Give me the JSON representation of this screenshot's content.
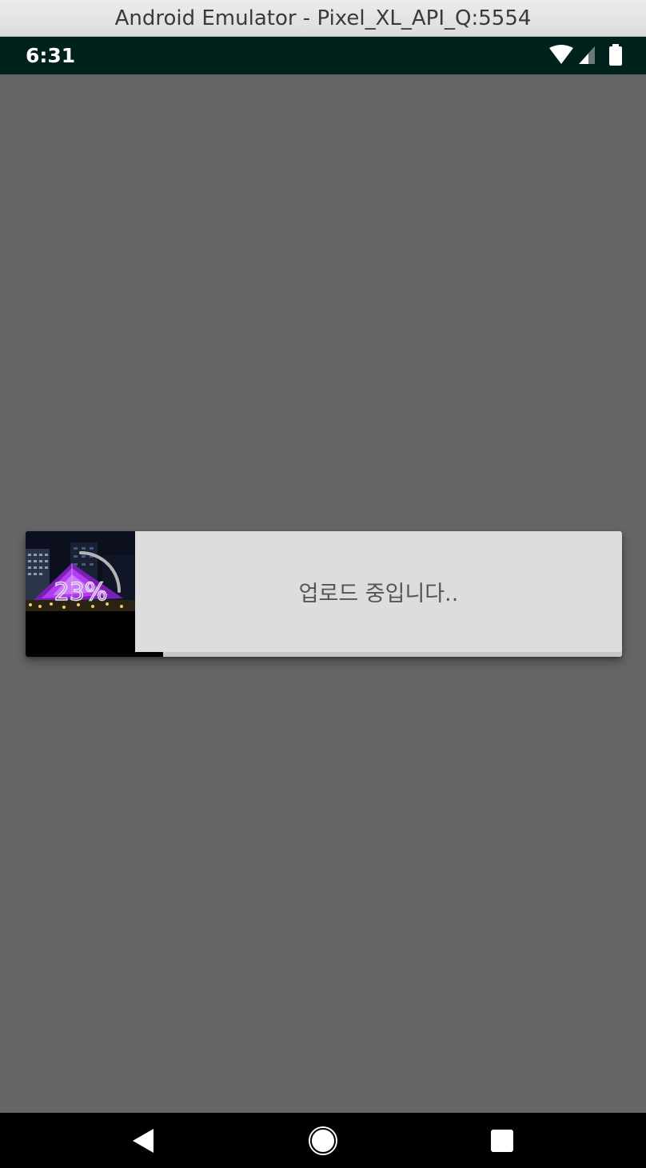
{
  "window": {
    "title": "Android Emulator - Pixel_XL_API_Q:5554"
  },
  "status_bar": {
    "time": "6:31",
    "icons": [
      "wifi-icon",
      "cellular-signal-icon",
      "battery-icon"
    ],
    "background": "#00221c"
  },
  "upload_dialog": {
    "message": "업로드 중입니다..",
    "percent_label": "23%",
    "progress": 0.23,
    "thumbnail": "night-illuminated-pyramid-photo",
    "accent": "#b23cf0"
  },
  "nav_bar": {
    "buttons": [
      "back-icon",
      "home-icon",
      "recents-icon"
    ]
  },
  "colors": {
    "screen_background": "#666666",
    "dialog_background": "#dddddd",
    "progress_fill": "#000000",
    "progress_track": "#c7c7c7"
  }
}
